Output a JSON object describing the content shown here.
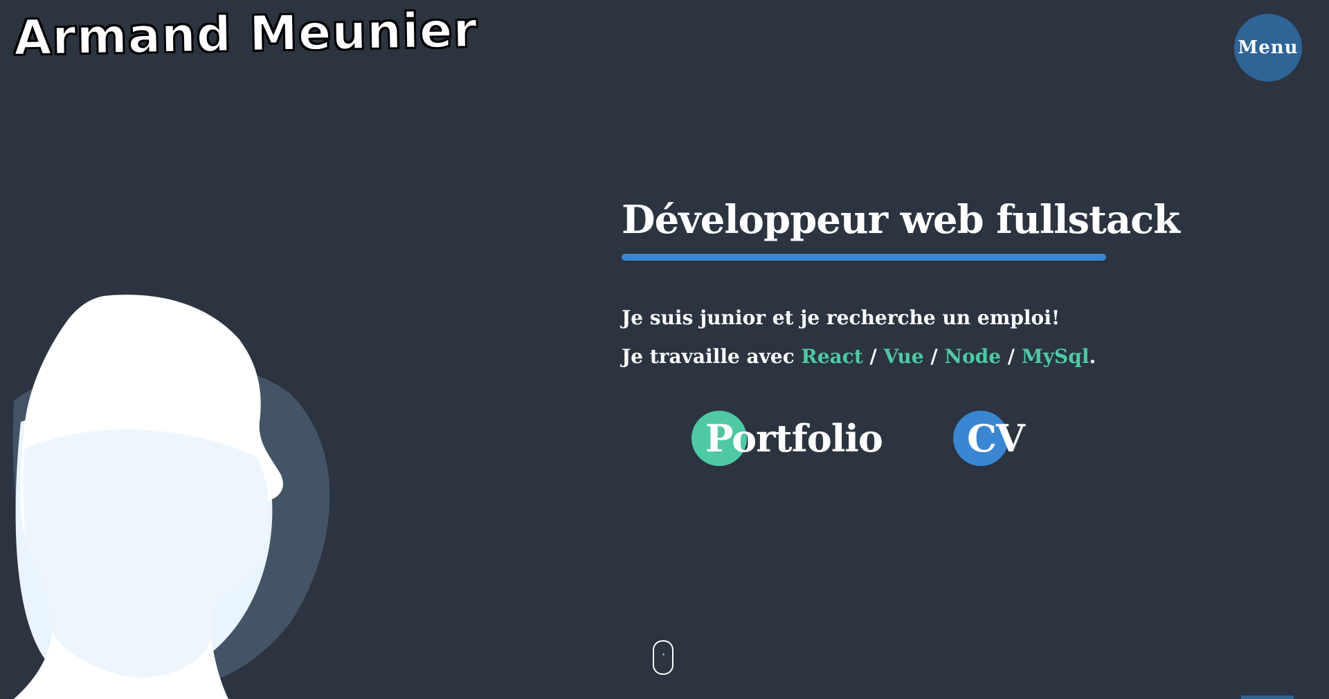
{
  "header": {
    "logo_text": "Armand Meunier",
    "menu_label": "Menu"
  },
  "hero": {
    "headline": "Développeur web fullstack",
    "intro": "Je suis junior et je recherche un emploi!",
    "stack_prefix": "Je travaille avec ",
    "technologies": [
      "React",
      "Vue",
      "Node",
      "MySql"
    ],
    "separator": " / ",
    "stack_suffix": "."
  },
  "actions": {
    "portfolio_label": "Portfolio",
    "cv_label": "CV"
  },
  "colors": {
    "background": "#2b3440",
    "accent_green": "#4fc9a4",
    "accent_blue": "#3a86d3",
    "menu_blue": "#2f6496",
    "portrait_light": "#eaf4fd",
    "portrait_shadow": "#425465"
  },
  "icons": {
    "scroll_indicator": "mouse-scroll-icon"
  }
}
